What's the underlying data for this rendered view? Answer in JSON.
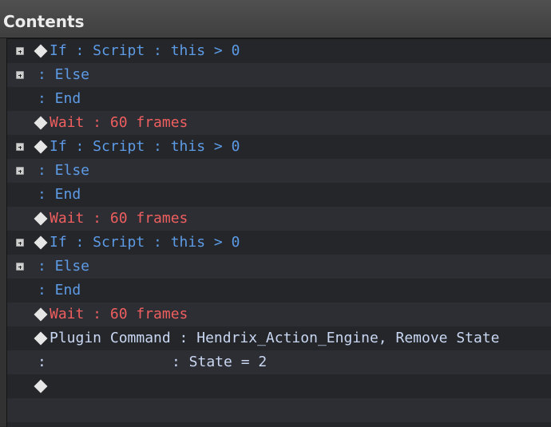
{
  "panel": {
    "title": "Contents"
  },
  "rows": [
    {
      "type": "if",
      "text": "If : Script : this > 0"
    },
    {
      "type": "else",
      "text": ": Else"
    },
    {
      "type": "end",
      "text": ": End"
    },
    {
      "type": "wait",
      "text": "Wait : 60 frames"
    },
    {
      "type": "if",
      "text": "If : Script : this > 0"
    },
    {
      "type": "else",
      "text": ": Else"
    },
    {
      "type": "end",
      "text": ": End"
    },
    {
      "type": "wait",
      "text": "Wait : 60 frames"
    },
    {
      "type": "if",
      "text": "If : Script : this > 0"
    },
    {
      "type": "else",
      "text": ": Else"
    },
    {
      "type": "end",
      "text": ": End"
    },
    {
      "type": "wait",
      "text": "Wait : 60 frames"
    },
    {
      "type": "plugin",
      "text": "Plugin Command : Hendrix_Action_Engine, Remove State"
    },
    {
      "type": "cont",
      "colon": ":",
      "text": ": State = 2"
    },
    {
      "type": "empty",
      "text": ""
    }
  ],
  "colors": {
    "branch": "#5d9be6",
    "wait": "#ef5f5f",
    "plugin": "#c9d7f2",
    "list_bg": "#24262a",
    "list_bg_alt": "#2c2e33"
  },
  "icons": {
    "toggle": "expand-icon",
    "bullet": "command-diamond-icon"
  }
}
